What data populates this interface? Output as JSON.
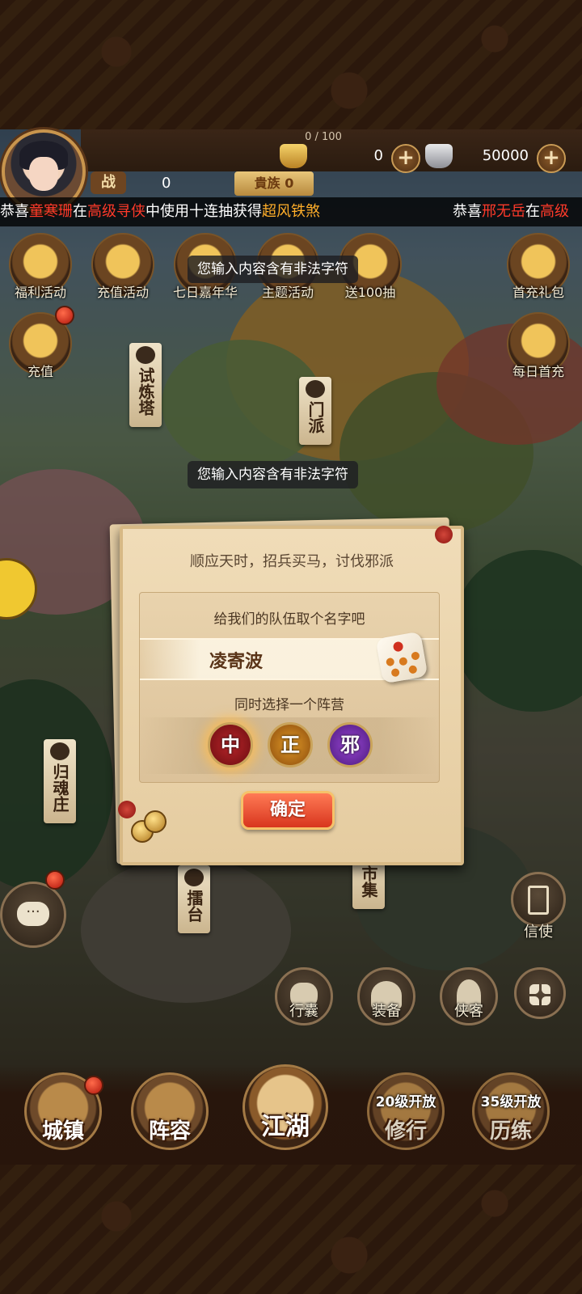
{
  "header": {
    "exp_text": "0 / 100",
    "gold": {
      "value": "0",
      "icon": "gold-ingot-icon"
    },
    "silver": {
      "value": "50000",
      "icon": "silver-ingot-icon"
    },
    "power": {
      "label": "战",
      "value": "0"
    },
    "noble": {
      "label": "貴族 0"
    }
  },
  "marquee": {
    "line1": [
      "恭喜",
      "童寒珊",
      "在",
      "高级寻侠",
      "中使用十连抽获得",
      "超风铁煞"
    ],
    "line2": [
      "恭喜",
      "邢无岳",
      "在",
      "高级"
    ]
  },
  "activities": [
    {
      "label": "福利活动"
    },
    {
      "label": "充值活动"
    },
    {
      "label": "七日嘉年华"
    },
    {
      "label": "主题活动"
    },
    {
      "label": "送100抽"
    },
    {
      "label": "首充礼包"
    },
    {
      "label": "充值"
    },
    {
      "label": "每日首充"
    }
  ],
  "map_signs": {
    "trial_tower": "试炼塔",
    "sect": "门派",
    "soul_village": "归魂庄",
    "arena": "擂台",
    "market": "市集"
  },
  "toasts": {
    "toast1": "您输入内容含有非法字符",
    "toast2": "您输入内容含有非法字符"
  },
  "side": {
    "messenger": "信使",
    "bag": "行囊",
    "equip": "装备",
    "hero": "侠客"
  },
  "nav": {
    "town": "城镇",
    "lineup": "阵容",
    "jianghu": "江湖",
    "practice": "修行",
    "practice_lock": "20级开放",
    "training": "历练",
    "training_lock": "35级开放"
  },
  "dialog": {
    "title": "顺应天时，招兵买马，讨伐邪派",
    "name_prompt": "给我们的队伍取个名字吧",
    "name_value": "凌寄波",
    "camp_prompt": "同时选择一个阵营",
    "camps": [
      "中",
      "正",
      "邪"
    ],
    "selected_camp": "中",
    "confirm": "确定"
  },
  "colors": {
    "marquee_name": "#ff3a2a",
    "marquee_item": "#ffae2a",
    "confirm_button": "#d8361e",
    "dialog_bg": "#f0dcb8"
  }
}
